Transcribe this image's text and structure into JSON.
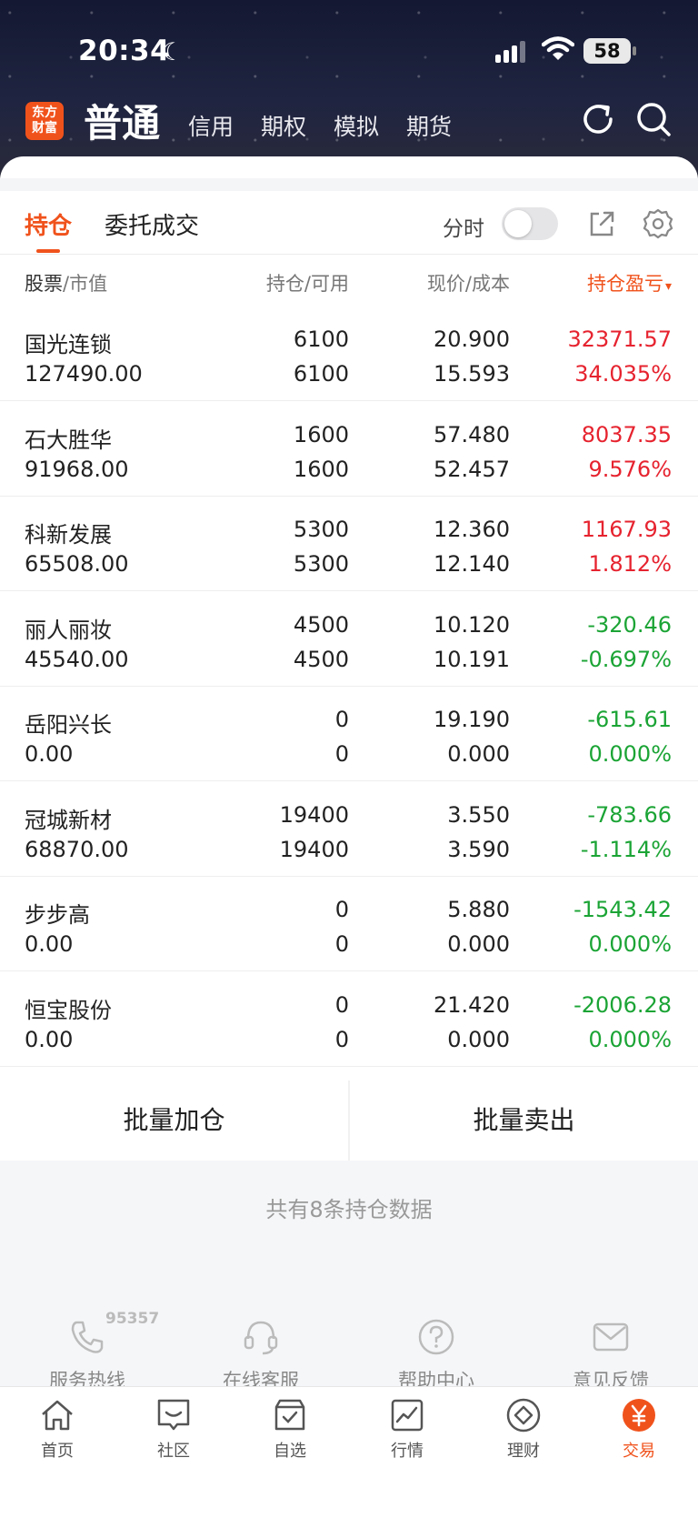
{
  "status_bar": {
    "time": "20:34",
    "battery": "58"
  },
  "appbar": {
    "logo_line1": "东方",
    "logo_line2": "财富",
    "active_mode": "普通",
    "mode_tabs": [
      "信用",
      "期权",
      "模拟",
      "期货"
    ]
  },
  "tabs": {
    "positions": "持仓",
    "orders": "委托成交",
    "intraday_label": "分时",
    "intraday_enabled": false
  },
  "table_header": {
    "stock": "股票",
    "market_value": "/市值",
    "holding": "持仓",
    "available": "/可用",
    "price": "现价",
    "cost": "/成本",
    "pl": "持仓盈亏"
  },
  "positions": [
    {
      "name": "国光连锁",
      "market_value": "127490.00",
      "holding": "6100",
      "available": "6100",
      "price": "20.900",
      "cost": "15.593",
      "pl": "32371.57",
      "pl_pct": "34.035%",
      "trend": "up"
    },
    {
      "name": "石大胜华",
      "market_value": "91968.00",
      "holding": "1600",
      "available": "1600",
      "price": "57.480",
      "cost": "52.457",
      "pl": "8037.35",
      "pl_pct": "9.576%",
      "trend": "up"
    },
    {
      "name": "科新发展",
      "market_value": "65508.00",
      "holding": "5300",
      "available": "5300",
      "price": "12.360",
      "cost": "12.140",
      "pl": "1167.93",
      "pl_pct": "1.812%",
      "trend": "up"
    },
    {
      "name": "丽人丽妆",
      "market_value": "45540.00",
      "holding": "4500",
      "available": "4500",
      "price": "10.120",
      "cost": "10.191",
      "pl": "-320.46",
      "pl_pct": "-0.697%",
      "trend": "down"
    },
    {
      "name": "岳阳兴长",
      "market_value": "0.00",
      "holding": "0",
      "available": "0",
      "price": "19.190",
      "cost": "0.000",
      "pl": "-615.61",
      "pl_pct": "0.000%",
      "trend": "down"
    },
    {
      "name": "冠城新材",
      "market_value": "68870.00",
      "holding": "19400",
      "available": "19400",
      "price": "3.550",
      "cost": "3.590",
      "pl": "-783.66",
      "pl_pct": "-1.114%",
      "trend": "down"
    },
    {
      "name": "步步高",
      "market_value": "0.00",
      "holding": "0",
      "available": "0",
      "price": "5.880",
      "cost": "0.000",
      "pl": "-1543.42",
      "pl_pct": "0.000%",
      "trend": "down"
    },
    {
      "name": "恒宝股份",
      "market_value": "0.00",
      "holding": "0",
      "available": "0",
      "price": "21.420",
      "cost": "0.000",
      "pl": "-2006.28",
      "pl_pct": "0.000%",
      "trend": "down"
    }
  ],
  "actions": {
    "batch_add": "批量加仓",
    "batch_sell": "批量卖出"
  },
  "summary": "共有8条持仓数据",
  "service": {
    "hotline_number": "95357",
    "hotline": "服务热线",
    "online": "在线客服",
    "help": "帮助中心",
    "feedback": "意见反馈"
  },
  "tabbar": {
    "home": "首页",
    "community": "社区",
    "watchlist": "自选",
    "market": "行情",
    "wealth": "理财",
    "trade": "交易"
  },
  "colors": {
    "accent": "#f0521c",
    "up": "#e6232f",
    "down": "#1ba435"
  }
}
